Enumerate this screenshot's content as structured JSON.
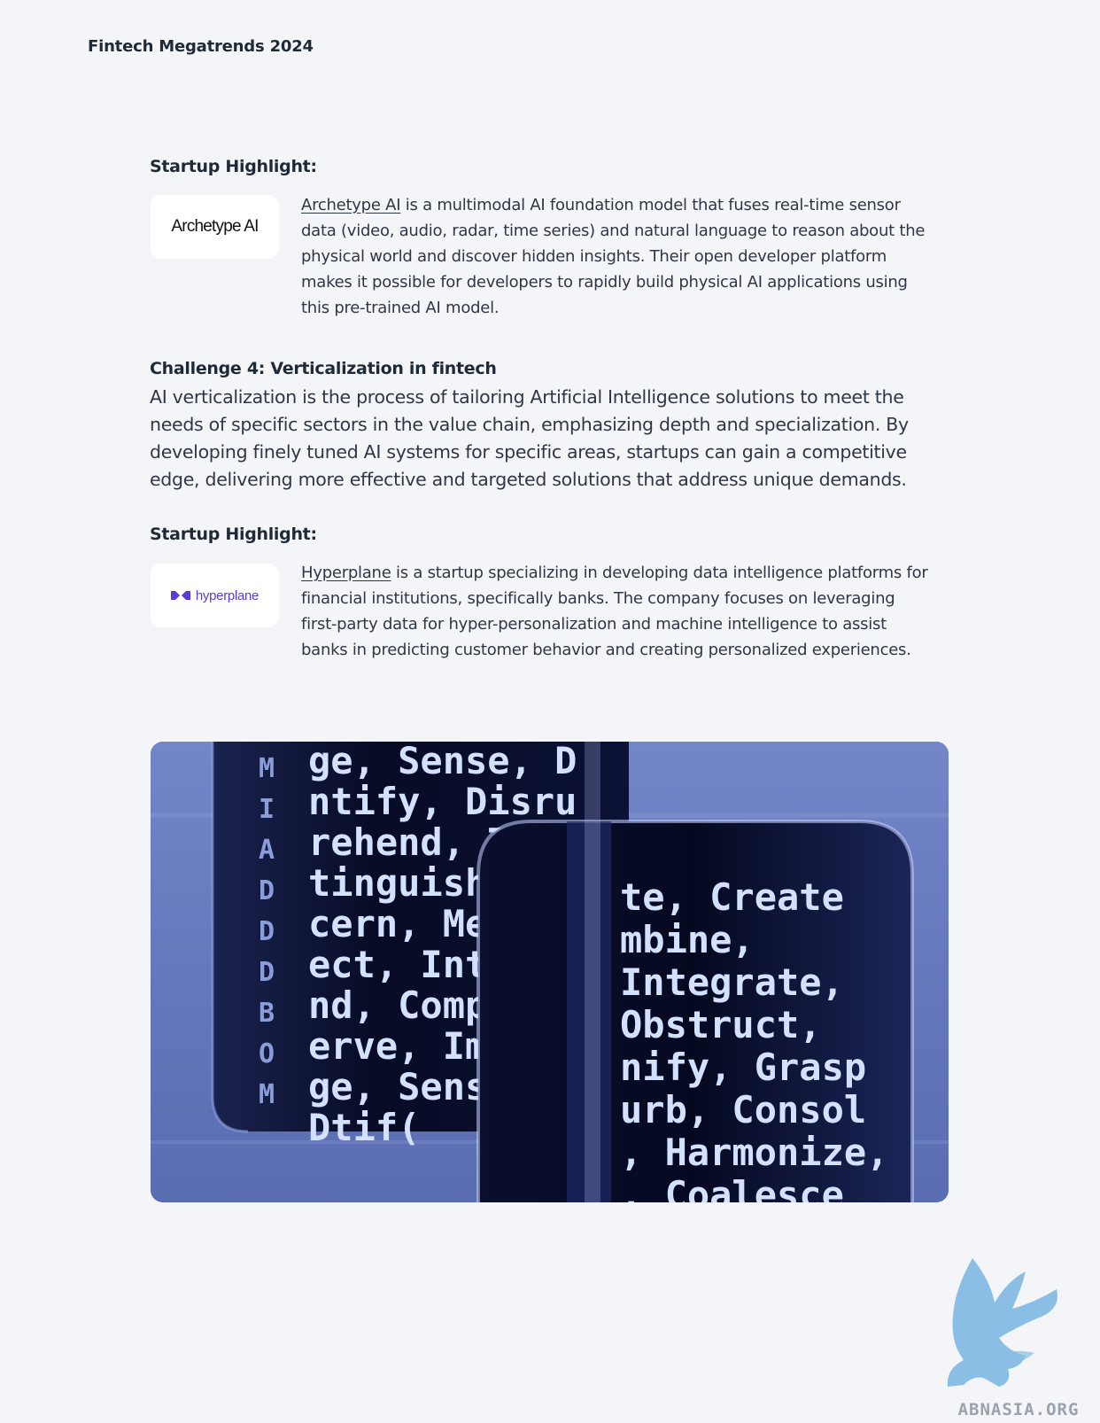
{
  "header": {
    "title": "Fintech Megatrends 2024"
  },
  "highlight1": {
    "heading": "Startup Highlight:",
    "logo_text": "Archetype AI",
    "link_text": "Archetype AI",
    "description": " is a multimodal AI foundation model that fuses real-time sensor data (video, audio, radar, time series) and natural language to reason about the physical world and discover hidden insights. Their open developer platform makes it possible for developers to rapidly build physical AI applications using this pre-trained AI model."
  },
  "challenge": {
    "heading": "Challenge 4: Verticalization in fintech",
    "body": "AI verticalization is the process of tailoring Artificial Intelligence solutions to meet the needs of specific sectors in the value chain, emphasizing depth and specialization. By developing finely tuned AI systems for specific areas, startups can gain a competitive edge, delivering more effective and targeted solutions that address unique demands."
  },
  "highlight2": {
    "heading": "Startup Highlight:",
    "logo_text": "hyperplane",
    "link_text": "Hyperplane",
    "description": " is a startup specializing in developing data intelligence platforms for financial institutions, specifically banks. The company focuses on leveraging first-party data for hyper-personalization and machine intelligence to assist banks in predicting customer behavior and creating personalized experiences."
  },
  "hero_image": {
    "left_lines": [
      "ge, Sense, D",
      "ntify, Disru",
      "rehend, T",
      "tinguish",
      "cern, Me",
      "ect, Int",
      "nd, Comp",
      "erve, Im",
      "ge, Sens",
      "Dtif("
    ],
    "left_column": [
      "M",
      "I",
      "A",
      "D",
      "D",
      "D",
      "B",
      "O",
      "M"
    ],
    "right_lines": [
      "te, Create",
      "mbine,",
      "Integrate,",
      "Obstruct,",
      "nify, Grasp",
      "urb, Consol",
      ", Harmonize,",
      ", Coalesce"
    ],
    "colors": {
      "background": "#6a7fc0",
      "glass": "#0b1030",
      "code": "#c8d6ff"
    }
  },
  "watermark": {
    "text": "ABNASIA.ORG",
    "color": "#7fb9e3"
  }
}
